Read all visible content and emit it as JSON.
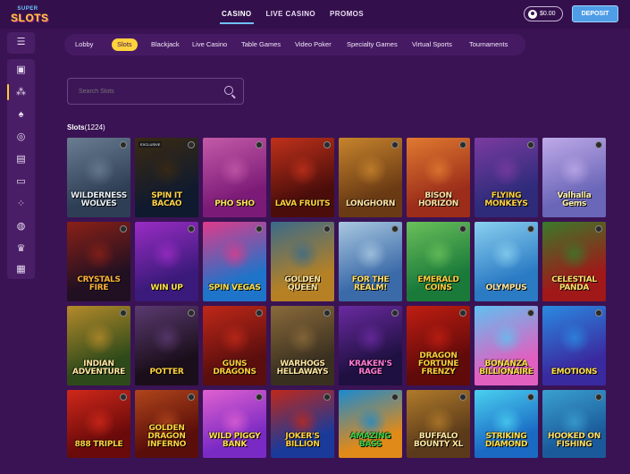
{
  "header": {
    "logo_top": "SUPER",
    "logo_main": "SLOTS",
    "nav": [
      {
        "label": "CASINO",
        "active": true
      },
      {
        "label": "LIVE CASINO",
        "active": false
      },
      {
        "label": "PROMOS",
        "active": false
      }
    ],
    "balance": "$0.00",
    "deposit_label": "DEPOSIT"
  },
  "sidebar": {
    "icons": [
      "menu-icon",
      "slots-cards-icon",
      "cherry-icon",
      "spade-icon",
      "roulette-icon",
      "cards-icon",
      "laptop-icon",
      "dice-icon",
      "basketball-icon",
      "trophy-icon",
      "gift-icon"
    ]
  },
  "categories": [
    {
      "label": "Lobby",
      "active": false
    },
    {
      "label": "Slots",
      "active": true
    },
    {
      "label": "Blackjack",
      "active": false
    },
    {
      "label": "Live Casino",
      "active": false
    },
    {
      "label": "Table Games",
      "active": false
    },
    {
      "label": "Video Poker",
      "active": false
    },
    {
      "label": "Specialty Games",
      "active": false
    },
    {
      "label": "Virtual Sports",
      "active": false
    },
    {
      "label": "Tournaments",
      "active": false
    }
  ],
  "search": {
    "placeholder": "Search Slots"
  },
  "section": {
    "title": "Slots",
    "count": "(1224)"
  },
  "games": [
    {
      "name": "WILDERNESS WOLVES",
      "bg": "#2d3e55",
      "bg2": "#6a7d92",
      "tc": "#e6eef5"
    },
    {
      "name": "SPIN IT BACAO",
      "bg": "#101a2e",
      "bg2": "#3a2a12",
      "tc": "#ffd54a",
      "excl": "EXCLUSIVE"
    },
    {
      "name": "PHO SHO",
      "bg": "#7c1b77",
      "bg2": "#c45aa8",
      "tc": "#ffe35a"
    },
    {
      "name": "LAVA FRUITS",
      "bg": "#4a0d0a",
      "bg2": "#c0311b",
      "tc": "#ffcf3a"
    },
    {
      "name": "LONGHORN",
      "bg": "#6a3a14",
      "bg2": "#c7842c",
      "tc": "#ffe2a4"
    },
    {
      "name": "BISON HORIZON",
      "bg": "#9c2d1a",
      "bg2": "#e07a30",
      "tc": "#ffe0a0"
    },
    {
      "name": "FLYING MONKEYS",
      "bg": "#2d2b7a",
      "bg2": "#7b3ba0",
      "tc": "#ffd23e"
    },
    {
      "name": "Valhalla Gems",
      "bg": "#6a66b8",
      "bg2": "#bfa9e8",
      "tc": "#fff3b0"
    },
    {
      "name": "CRYSTALS FIRE",
      "bg": "#201022",
      "bg2": "#8a2016",
      "tc": "#ffb33a"
    },
    {
      "name": "WIN UP",
      "bg": "#3a1a7a",
      "bg2": "#9a2cc4",
      "tc": "#ffe04a"
    },
    {
      "name": "SPIN VEGAS",
      "bg": "#1e74c9",
      "bg2": "#e03a8a",
      "tc": "#ffe04a"
    },
    {
      "name": "GOLDEN QUEEN",
      "bg": "#b58124",
      "bg2": "#3a6a8a",
      "tc": "#ffe6a0"
    },
    {
      "name": "FOR THE REALM!",
      "bg": "#3a6aa8",
      "bg2": "#a9c7e0",
      "tc": "#ffe06a"
    },
    {
      "name": "EMERALD COINS",
      "bg": "#1a7a3a",
      "bg2": "#6ac05a",
      "tc": "#ffd23e"
    },
    {
      "name": "OLYMPUS",
      "bg": "#2a7ac4",
      "bg2": "#8ad0f0",
      "tc": "#ffe6a0"
    },
    {
      "name": "CELESTIAL PANDA",
      "bg": "#a01818",
      "bg2": "#3a7a2a",
      "tc": "#ffe06a"
    },
    {
      "name": "INDIAN ADVENTURE",
      "bg": "#2e4a1a",
      "bg2": "#b58a2a",
      "tc": "#ffe6a0"
    },
    {
      "name": "POTTER",
      "bg": "#1a0e1a",
      "bg2": "#5a3a70",
      "tc": "#ffd23e"
    },
    {
      "name": "GUNS DRAGONS",
      "bg": "#5a0e0e",
      "bg2": "#c02818",
      "tc": "#ffcf3a"
    },
    {
      "name": "WARHOGS HELLAWAYS",
      "bg": "#3a3020",
      "bg2": "#8a6a3a",
      "tc": "#ffe6a0"
    },
    {
      "name": "KRAKEN'S RAGE",
      "bg": "#1e1040",
      "bg2": "#6a2aa0",
      "tc": "#ff7ad8"
    },
    {
      "name": "DRAGON FORTUNE FRENZY",
      "bg": "#600a0a",
      "bg2": "#c01e12",
      "tc": "#ffcf3a"
    },
    {
      "name": "BONANZA BILLIONAIRE",
      "bg": "#e060c0",
      "bg2": "#60c0f0",
      "tc": "#ffe04a"
    },
    {
      "name": "EMOTIONS",
      "bg": "#3a2aa0",
      "bg2": "#2a8ae0",
      "tc": "#ffe04a"
    },
    {
      "name": "888 TRIPLE",
      "bg": "#6a0a0a",
      "bg2": "#d0281a",
      "tc": "#ffd23e"
    },
    {
      "name": "GOLDEN DRAGON INFERNO",
      "bg": "#5a0e0a",
      "bg2": "#b0451a",
      "tc": "#ffd23e"
    },
    {
      "name": "WILD PIGGY BANK",
      "bg": "#7a2ac4",
      "bg2": "#e060d0",
      "tc": "#ffe04a"
    },
    {
      "name": "JOKER'S BILLION",
      "bg": "#1a3a9a",
      "bg2": "#c0281a",
      "tc": "#ffd23e"
    },
    {
      "name": "AMAZING BASS",
      "bg": "#e08a1a",
      "bg2": "#1a8ad0",
      "tc": "#3ad04a"
    },
    {
      "name": "BUFFALO BOUNTY XL",
      "bg": "#5a3a1a",
      "bg2": "#b07a2a",
      "tc": "#ffe6a0"
    },
    {
      "name": "STRIKING DIAMOND",
      "bg": "#1a6ac4",
      "bg2": "#4ad0f0",
      "tc": "#ffe04a"
    },
    {
      "name": "HOOKED ON FISHING",
      "bg": "#1a5a9a",
      "bg2": "#3aa0d0",
      "tc": "#ffe06a"
    }
  ]
}
